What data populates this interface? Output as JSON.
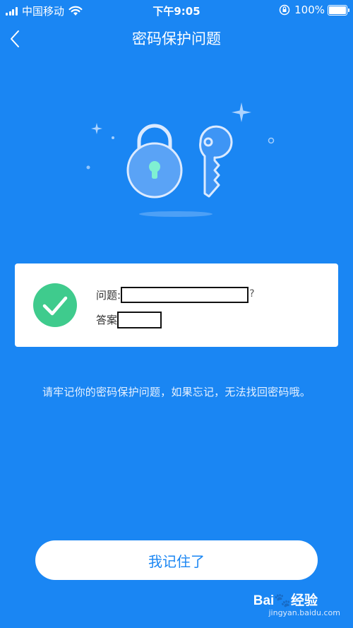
{
  "status_bar": {
    "carrier": "中国移动",
    "time": "下午9:05",
    "battery_percent": "100%",
    "battery_level": 1.0,
    "wifi_icon": "wifi-icon",
    "lock_icon": "orientation-lock-icon"
  },
  "nav": {
    "back_icon": "chevron-left-icon",
    "title": "密码保护问题"
  },
  "card": {
    "question_label": "问题:",
    "question_suffix": "?",
    "answer_label": "答案",
    "check_icon": "check-circle-icon"
  },
  "hint": "请牢记你的密码保护问题，如果忘记，无法找回密码哦。",
  "confirm_button": "我记住了",
  "watermark": {
    "logo": "Bai🐾经验",
    "url": "jingyan.baidu.com"
  },
  "colors": {
    "background": "#1a86f3",
    "check_green": "#3fcb8d",
    "button_text": "#1a86f3"
  }
}
